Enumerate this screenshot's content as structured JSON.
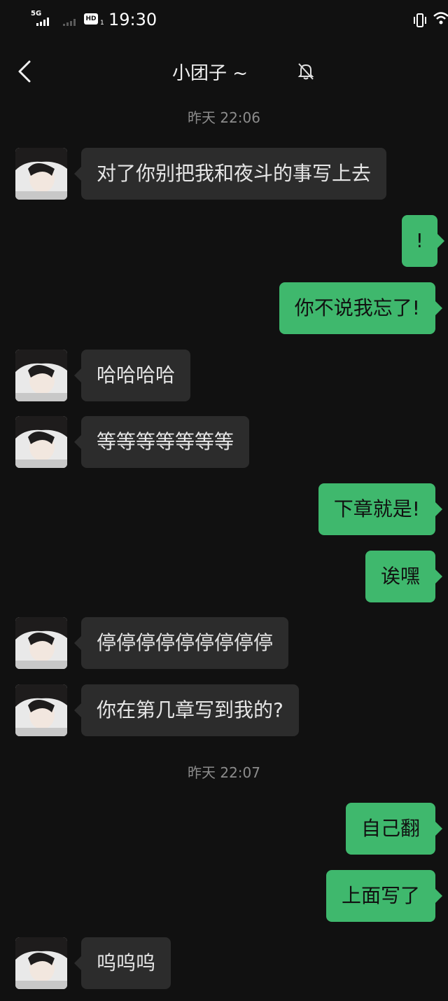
{
  "status_bar": {
    "network": "5G",
    "hd_label": "HD",
    "hd_sub": "1",
    "time": "19:30"
  },
  "header": {
    "title": "小团子 ~",
    "back_icon": "chevron-left-icon",
    "mute_icon": "bell-off-icon"
  },
  "colors": {
    "background": "#111111",
    "incoming_bubble": "#2c2c2c",
    "outgoing_bubble": "#3fb86d",
    "timestamp": "#8c8c8c"
  },
  "chat": {
    "timestamps": [
      "昨天 22:06",
      "昨天 22:07"
    ],
    "messages": [
      {
        "from": "them",
        "text": "对了你别把我和夜斗的事写上去"
      },
      {
        "from": "me",
        "text": "!"
      },
      {
        "from": "me",
        "text": "你不说我忘了!"
      },
      {
        "from": "them",
        "text": "哈哈哈哈"
      },
      {
        "from": "them",
        "text": "等等等等等等等"
      },
      {
        "from": "me",
        "text": "下章就是!"
      },
      {
        "from": "me",
        "text": "诶嘿"
      },
      {
        "from": "them",
        "text": "停停停停停停停停停"
      },
      {
        "from": "them",
        "text": "你在第几章写到我的?"
      },
      {
        "from": "me",
        "text": "自己翻"
      },
      {
        "from": "me",
        "text": "上面写了"
      },
      {
        "from": "them",
        "text": "呜呜呜"
      }
    ]
  }
}
